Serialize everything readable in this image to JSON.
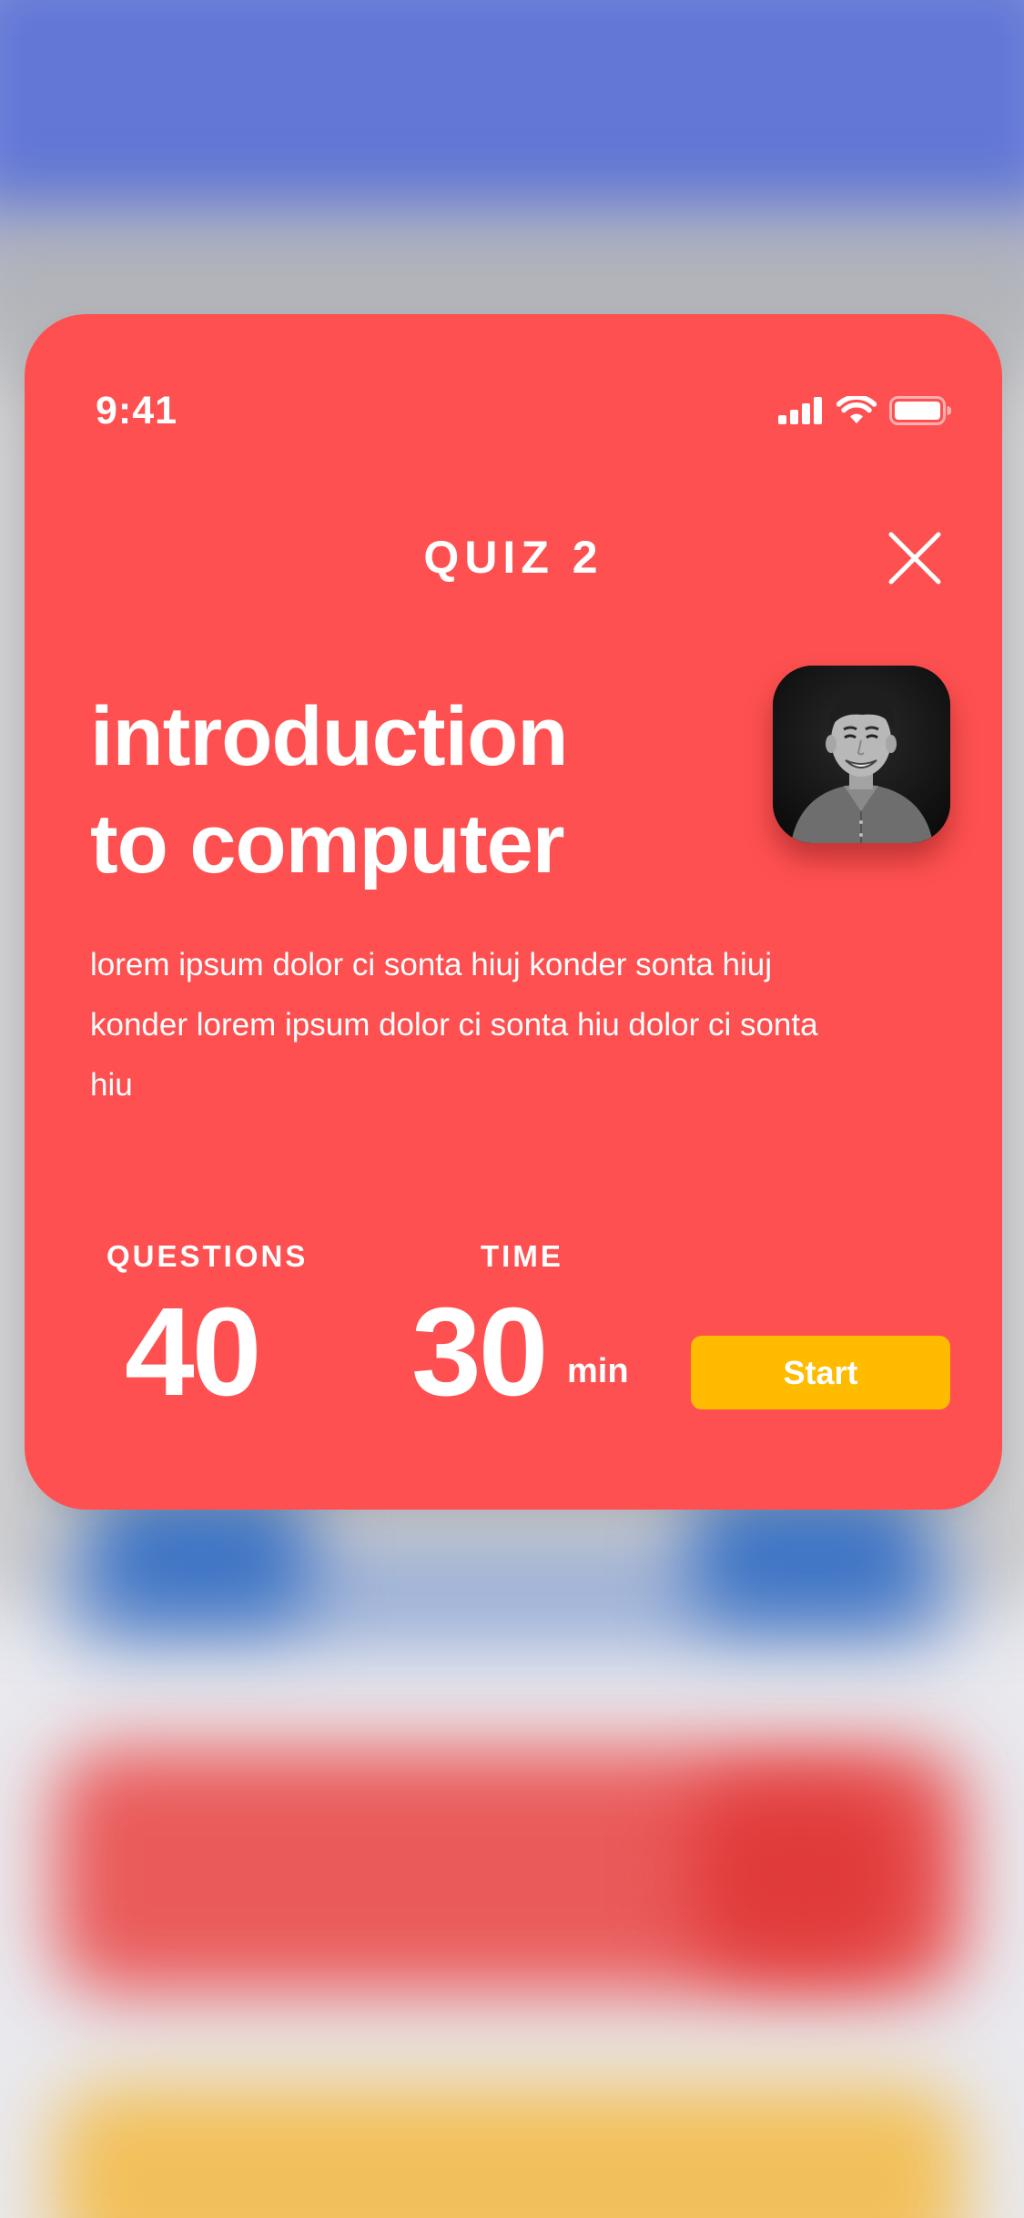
{
  "status_bar": {
    "time": "9:41",
    "icons": [
      "cellular-signal-icon",
      "wifi-icon",
      "battery-icon"
    ]
  },
  "quiz": {
    "label": "QUIZ 2",
    "close_icon": "close-icon",
    "title_line1": "introduction",
    "title_line2": "to computer",
    "description": "lorem ipsum dolor ci sonta hiuj konder  sonta hiuj konder lorem ipsum dolor ci sonta hiu dolor ci sonta hiu",
    "avatar_alt": "instructor-portrait"
  },
  "stats": {
    "questions_label": "QUESTIONS",
    "questions_value": "40",
    "time_label": "TIME",
    "time_value": "30",
    "time_unit": "min"
  },
  "actions": {
    "start_label": "Start"
  },
  "colors": {
    "card_background": "#fe5050",
    "start_button": "#ffbb00",
    "text": "#ffffff"
  }
}
